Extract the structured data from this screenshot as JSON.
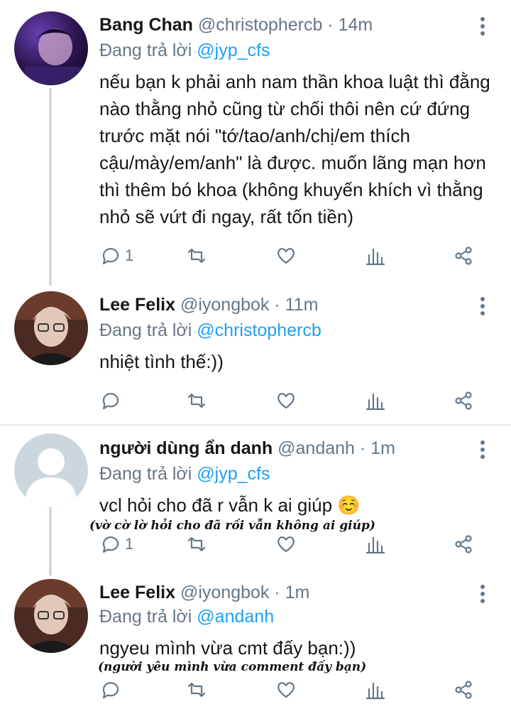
{
  "tweets": [
    {
      "name": "Bang Chan",
      "handle": "@christophercb · 14m",
      "reply_prefix": "Đang trả lời",
      "reply_to": "@jyp_cfs",
      "text": "nếu bạn k phải anh nam thần khoa luật thì đằng nào thằng nhỏ cũng từ chối thôi nên cứ đứng trước mặt nói \"tớ/tao/anh/chị/em thích cậu/mày/em/anh\" là được. muốn lãng mạn hơn thì thêm bó khoa (không khuyến khích vì thằng nhỏ sẽ vứt đi ngay, rất tốn tiền)",
      "reply_count": "1",
      "annotation": ""
    },
    {
      "name": "Lee Felix",
      "handle": "@iyongbok · 11m",
      "reply_prefix": "Đang trả lời",
      "reply_to": "@christophercb",
      "text": "nhiệt tình thế:))",
      "reply_count": "",
      "annotation": ""
    },
    {
      "name": "người dùng ẩn danh",
      "handle": "@andanh · 1m",
      "reply_prefix": "Đang trả lời",
      "reply_to": "@jyp_cfs",
      "text": "vcl hỏi cho đã r vẫn k ai giúp ☺️",
      "reply_count": "1",
      "annotation": "(vờ cờ lờ hỏi cho đã rồi vẫn không ai giúp)"
    },
    {
      "name": "Lee Felix",
      "handle": "@iyongbok · 1m",
      "reply_prefix": "Đang trả lời",
      "reply_to": "@andanh",
      "text": "ngyeu mình vừa cmt đấy bạn:))",
      "reply_count": "",
      "annotation": "(người yêu mình vừa comment đấy bạn)"
    }
  ],
  "icons": [
    "reply-icon",
    "retweet-icon",
    "like-icon",
    "analytics-icon",
    "share-icon",
    "more-options-icon"
  ],
  "colors": {
    "link": "#1da1f2",
    "muted": "#657786",
    "text": "#14171a",
    "thread_line": "#cfd9de"
  }
}
